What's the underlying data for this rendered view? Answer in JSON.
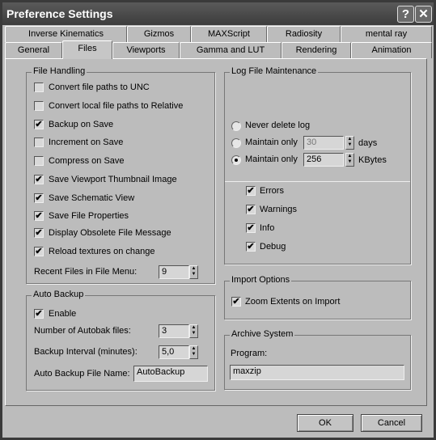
{
  "window": {
    "title": "Preference Settings",
    "help": "?",
    "close": "✕"
  },
  "tabs_row1": [
    "Inverse Kinematics",
    "Gizmos",
    "MAXScript",
    "Radiosity",
    "mental ray"
  ],
  "tabs_row2": [
    "General",
    "Files",
    "Viewports",
    "Gamma and LUT",
    "Rendering",
    "Animation"
  ],
  "selected_tab": "Files",
  "file_handling": {
    "title": "File Handling",
    "items": [
      {
        "label": "Convert file paths to UNC",
        "checked": false
      },
      {
        "label": "Convert local file paths to Relative",
        "checked": false
      },
      {
        "label": "Backup on Save",
        "checked": true
      },
      {
        "label": "Increment on Save",
        "checked": false
      },
      {
        "label": "Compress on Save",
        "checked": false
      },
      {
        "label": "Save Viewport Thumbnail Image",
        "checked": true
      },
      {
        "label": "Save Schematic View",
        "checked": true
      },
      {
        "label": "Save File Properties",
        "checked": true
      },
      {
        "label": "Display Obsolete File Message",
        "checked": true
      },
      {
        "label": "Reload textures on change",
        "checked": true
      }
    ],
    "recent_label": "Recent Files in File Menu:",
    "recent_value": "9"
  },
  "auto_backup": {
    "title": "Auto Backup",
    "enable_label": "Enable",
    "enable": true,
    "num_label": "Number of Autobak files:",
    "num_value": "3",
    "interval_label": "Backup Interval (minutes):",
    "interval_value": "5,0",
    "name_label": "Auto Backup File Name:",
    "name_value": "AutoBackup"
  },
  "log": {
    "title": "Log File Maintenance",
    "never": "Never delete log",
    "maintain1": "Maintain only",
    "days_value": "30",
    "days_unit": "days",
    "maintain2": "Maintain only",
    "kb_value": "256",
    "kb_unit": "KBytes",
    "selected": "kbytes",
    "checks": [
      {
        "label": "Errors",
        "checked": true
      },
      {
        "label": "Warnings",
        "checked": true
      },
      {
        "label": "Info",
        "checked": true
      },
      {
        "label": "Debug",
        "checked": true
      }
    ]
  },
  "import": {
    "title": "Import Options",
    "zoom_label": "Zoom Extents on Import",
    "zoom": true
  },
  "archive": {
    "title": "Archive System",
    "program_label": "Program:",
    "program_value": "maxzip"
  },
  "buttons": {
    "ok": "OK",
    "cancel": "Cancel"
  },
  "check_glyph": "✔"
}
